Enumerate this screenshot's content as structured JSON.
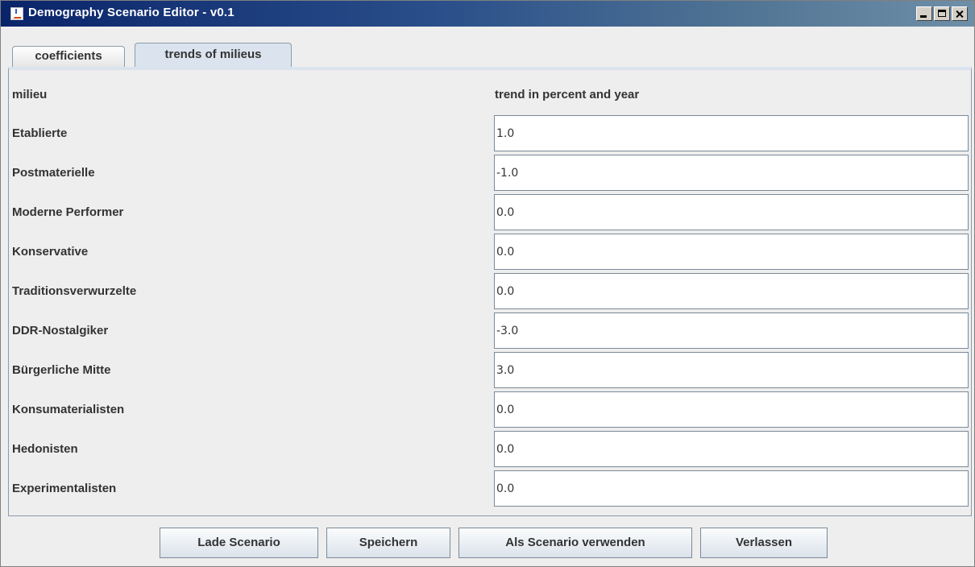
{
  "window": {
    "title": "Demography Scenario Editor - v0.1"
  },
  "tabs": [
    {
      "label": "coefficients",
      "selected": false
    },
    {
      "label": "trends of milieus",
      "selected": true
    }
  ],
  "table": {
    "headers": {
      "milieu": "milieu",
      "trend": "trend in percent and year"
    },
    "rows": [
      {
        "label": "Etablierte",
        "value": "1.0"
      },
      {
        "label": "Postmaterielle",
        "value": "-1.0"
      },
      {
        "label": "Moderne Performer",
        "value": "0.0"
      },
      {
        "label": "Konservative",
        "value": "0.0"
      },
      {
        "label": "Traditionsverwurzelte",
        "value": "0.0"
      },
      {
        "label": "DDR-Nostalgiker",
        "value": "-3.0"
      },
      {
        "label": "Bürgerliche Mitte",
        "value": "3.0"
      },
      {
        "label": "Konsumaterialisten",
        "value": "0.0"
      },
      {
        "label": "Hedonisten",
        "value": "0.0"
      },
      {
        "label": "Experimentalisten",
        "value": "0.0"
      }
    ]
  },
  "buttons": {
    "load": "Lade Scenario",
    "save": "Speichern",
    "use": "Als Scenario verwenden",
    "quit": "Verlassen"
  },
  "colors": {
    "titlebar_start": "#0a246a",
    "tab_selected": "#dbe4ee",
    "background": "#eeeeee"
  }
}
